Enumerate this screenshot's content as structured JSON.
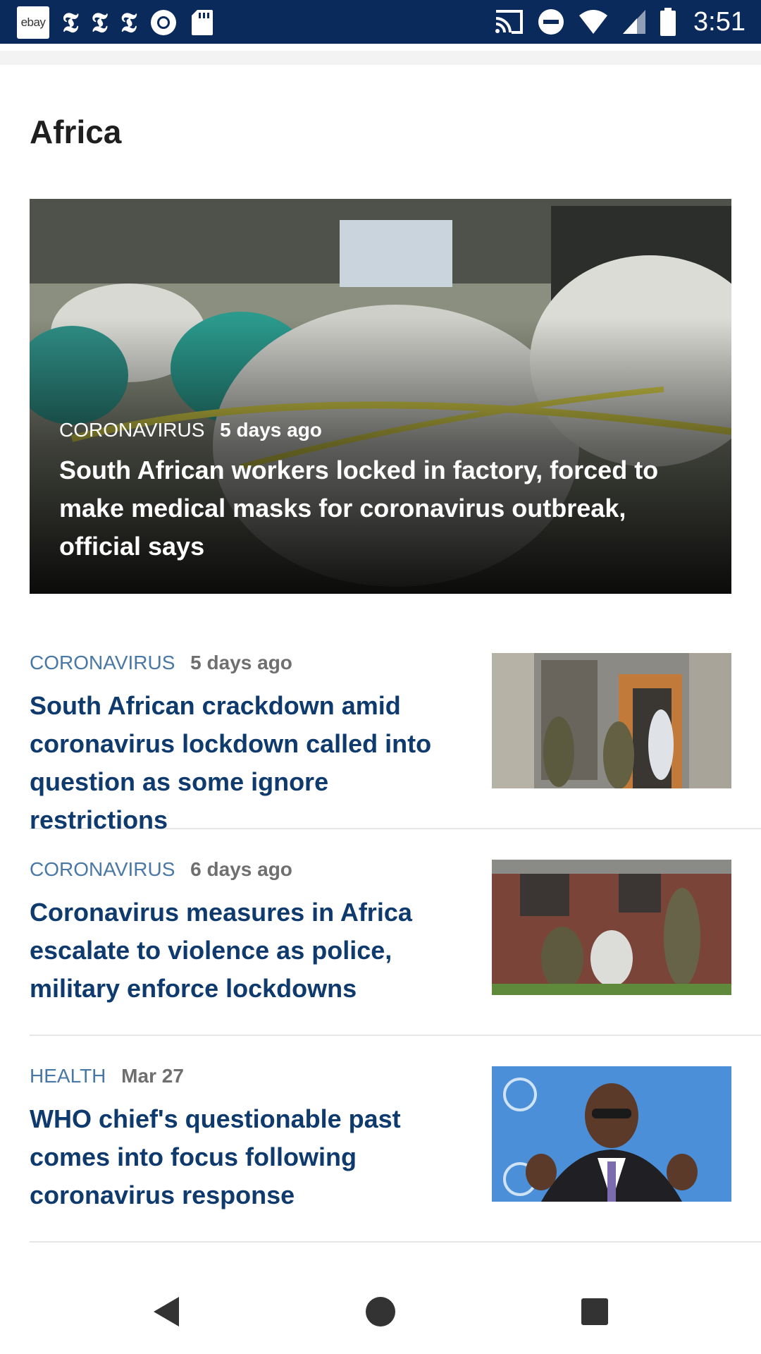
{
  "status_bar": {
    "time": "3:51",
    "left_icons": [
      "ebay-icon",
      "nyt-icon",
      "nyt-icon",
      "nyt-icon",
      "radio-icon",
      "sd-card-icon"
    ],
    "ebay_label": "ebay",
    "nyt_glyph": "𝕿",
    "right_icons": [
      "cast-icon",
      "do-not-disturb-icon",
      "wifi-icon",
      "signal-icon",
      "battery-icon"
    ]
  },
  "section": {
    "title": "Africa"
  },
  "hero": {
    "category": "CORONAVIRUS",
    "time": "5 days ago",
    "headline": "South African workers locked in factory, forced to make medical masks for coronavirus outbreak, official says"
  },
  "articles": [
    {
      "category": "CORONAVIRUS",
      "time": "5 days ago",
      "headline": "South African crackdown amid coronavirus lockdown called into question as some ignore restrictions"
    },
    {
      "category": "CORONAVIRUS",
      "time": "6 days ago",
      "headline": "Coronavirus measures in Africa escalate to violence as police, military enforce lockdowns"
    },
    {
      "category": "HEALTH",
      "time": "Mar 27",
      "headline": "WHO chief's questionable past comes into focus following coronavirus response"
    }
  ],
  "nav_bar": {
    "icons": [
      "back-icon",
      "home-icon",
      "recents-icon"
    ]
  },
  "colors": {
    "status_bar_bg": "#0b2a5c",
    "category_blue": "#4a78a6",
    "headline_navy": "#0e3a6e",
    "time_gray": "#6f6f6f"
  }
}
